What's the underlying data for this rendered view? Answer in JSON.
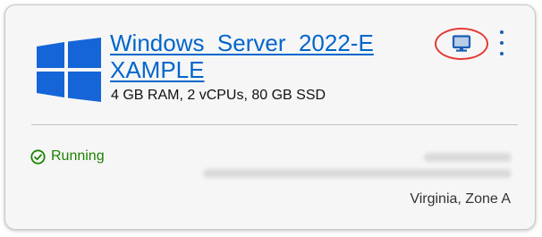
{
  "instance": {
    "name": "Windows_Server_2022-EXAMPLE",
    "specs": "4 GB RAM, 2 vCPUs, 80 GB SSD",
    "status": "Running",
    "location": "Virginia, Zone A"
  },
  "icons": {
    "logo": "windows-logo",
    "connect": "monitor-icon",
    "more": "vertical-ellipsis-icon",
    "status": "check-circle-icon"
  },
  "colors": {
    "link": "#0066cc",
    "running": "#1d8102",
    "highlight": "#e53935",
    "windows": "#1565d8"
  }
}
